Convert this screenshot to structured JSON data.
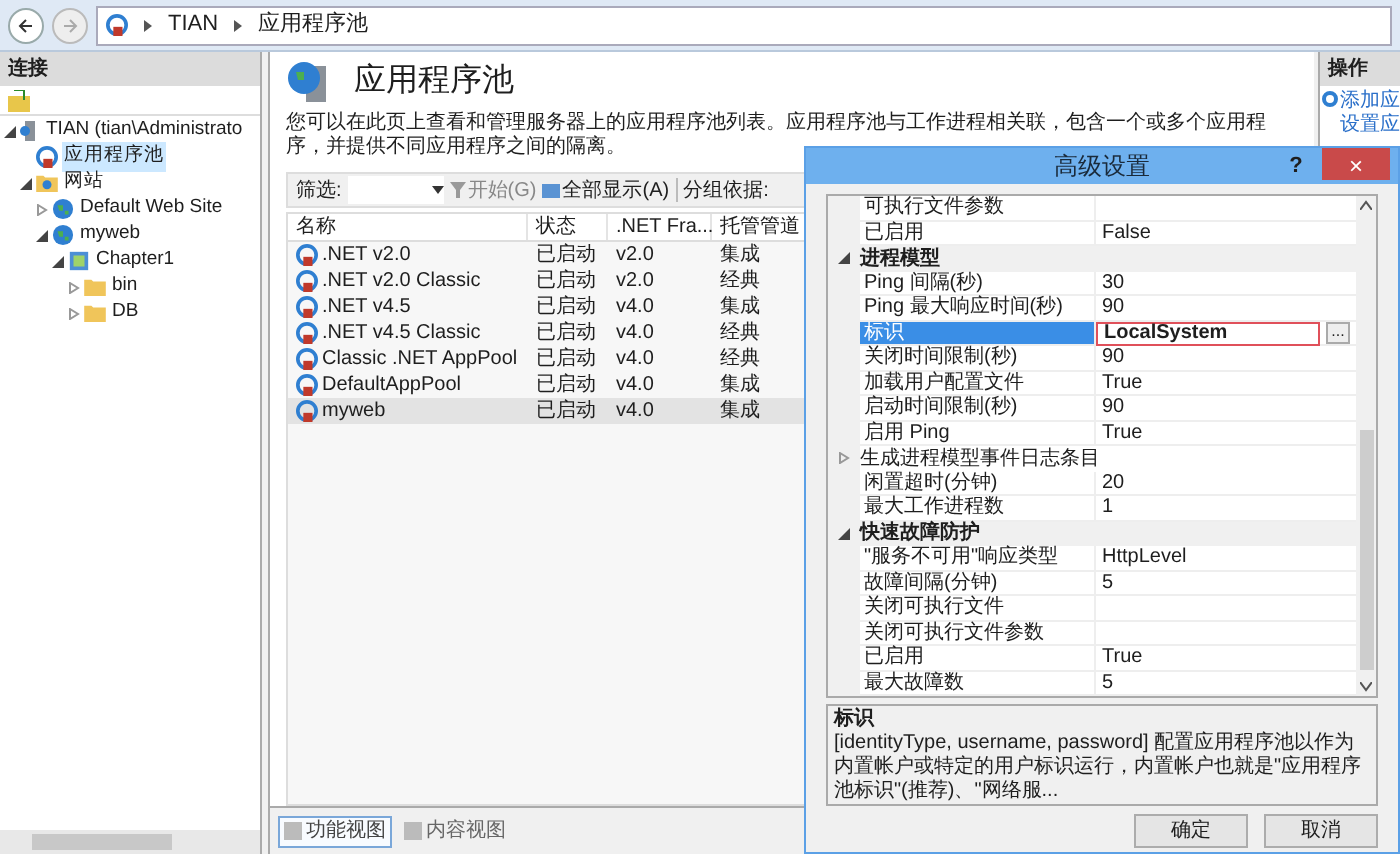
{
  "address_bar": {
    "crumbs": [
      "TIAN",
      "应用程序池"
    ]
  },
  "connections": {
    "title": "连接",
    "tree": [
      {
        "label": "TIAN (tian\\Administrato",
        "kind": "server",
        "selected": false,
        "expanded": true,
        "children": [
          {
            "label": "应用程序池",
            "kind": "pools",
            "selected": true
          },
          {
            "label": "网站",
            "kind": "sites",
            "selected": false,
            "expanded": true,
            "children": [
              {
                "label": "Default Web Site",
                "kind": "site",
                "selected": false,
                "expanded": false
              },
              {
                "label": "myweb",
                "kind": "site",
                "selected": false,
                "expanded": true,
                "children": [
                  {
                    "label": "Chapter1",
                    "kind": "app",
                    "selected": false,
                    "expanded": true,
                    "children": [
                      {
                        "label": "bin",
                        "kind": "folder",
                        "selected": false,
                        "expanded": false
                      },
                      {
                        "label": "DB",
                        "kind": "folder",
                        "selected": false,
                        "expanded": false
                      }
                    ]
                  }
                ]
              }
            ]
          }
        ]
      }
    ]
  },
  "page": {
    "title": "应用程序池",
    "description": "您可以在此页上查看和管理服务器上的应用程序池列表。应用程序池与工作进程相关联，包含一个或多个应用程序，并提供不同应用程序之间的隔离。"
  },
  "toolbar": {
    "filter_label": "筛选:",
    "start": "开始(G)",
    "show_all": "全部显示(A)",
    "group_by": "分组依据:"
  },
  "table": {
    "columns": [
      "名称",
      "状态",
      ".NET Fra...",
      "托管管道"
    ],
    "rows": [
      {
        "cells": [
          ".NET v2.0",
          "已启动",
          "v2.0",
          "集成"
        ],
        "selected": false
      },
      {
        "cells": [
          ".NET v2.0 Classic",
          "已启动",
          "v2.0",
          "经典"
        ],
        "selected": false
      },
      {
        "cells": [
          ".NET v4.5",
          "已启动",
          "v4.0",
          "集成"
        ],
        "selected": false
      },
      {
        "cells": [
          ".NET v4.5 Classic",
          "已启动",
          "v4.0",
          "经典"
        ],
        "selected": false
      },
      {
        "cells": [
          "Classic .NET AppPool",
          "已启动",
          "v4.0",
          "经典"
        ],
        "selected": false
      },
      {
        "cells": [
          "DefaultAppPool",
          "已启动",
          "v4.0",
          "集成"
        ],
        "selected": false
      },
      {
        "cells": [
          "myweb",
          "已启动",
          "v4.0",
          "集成"
        ],
        "selected": true
      }
    ]
  },
  "view_tabs": [
    {
      "label": "功能视图",
      "selected": true
    },
    {
      "label": "内容视图",
      "selected": false
    }
  ],
  "actions": {
    "title": "操作",
    "items": [
      "添加应",
      "设置应"
    ]
  },
  "dialog": {
    "title": "高级设置",
    "help": "?",
    "close": "×",
    "properties": [
      {
        "kind": "row",
        "name": "可执行文件参数",
        "selected": false,
        "outlined": false
      },
      {
        "kind": "row",
        "name": "已启用",
        "value": "False",
        "selected": false,
        "outlined": false
      },
      {
        "kind": "group",
        "name": "进程模型",
        "expanded": true
      },
      {
        "kind": "row",
        "name": "Ping 间隔(秒)",
        "value": "30",
        "selected": false,
        "outlined": false
      },
      {
        "kind": "row",
        "name": "Ping 最大响应时间(秒)",
        "value": "90",
        "selected": false,
        "outlined": false
      },
      {
        "kind": "row",
        "name": "标识",
        "value": "LocalSystem",
        "selected": true,
        "outlined": true
      },
      {
        "kind": "row",
        "name": "关闭时间限制(秒)",
        "value": "90",
        "selected": false,
        "outlined": false
      },
      {
        "kind": "row",
        "name": "加载用户配置文件",
        "value": "True",
        "selected": false,
        "outlined": false
      },
      {
        "kind": "row",
        "name": "启动时间限制(秒)",
        "value": "90",
        "selected": false,
        "outlined": false
      },
      {
        "kind": "row",
        "name": "启用 Ping",
        "value": "True",
        "selected": false,
        "outlined": false
      },
      {
        "kind": "subgroup",
        "name": "生成进程模型事件日志条目",
        "expanded": false
      },
      {
        "kind": "row",
        "name": "闲置超时(分钟)",
        "value": "20",
        "selected": false,
        "outlined": false
      },
      {
        "kind": "row",
        "name": "最大工作进程数",
        "value": "1",
        "selected": false,
        "outlined": false
      },
      {
        "kind": "group",
        "name": "快速故障防护",
        "expanded": true
      },
      {
        "kind": "row",
        "name": "\"服务不可用\"响应类型",
        "value": "HttpLevel",
        "selected": false,
        "outlined": false
      },
      {
        "kind": "row",
        "name": "故障间隔(分钟)",
        "value": "5",
        "selected": false,
        "outlined": false
      },
      {
        "kind": "row",
        "name": "关闭可执行文件",
        "selected": false,
        "outlined": false
      },
      {
        "kind": "row",
        "name": "关闭可执行文件参数",
        "selected": false,
        "outlined": false
      },
      {
        "kind": "row",
        "name": "已启用",
        "value": "True",
        "selected": false,
        "outlined": false
      },
      {
        "kind": "row",
        "name": "最大故障数",
        "value": "5",
        "selected": false,
        "outlined": false
      }
    ],
    "edit_button": "...",
    "help_title": "标识",
    "help_text": "[identityType, username, password] 配置应用程序池以作为内置帐户或特定的用户标识运行，内置帐户也就是\"应用程序池标识\"(推荐)、\"网络服...",
    "buttons": [
      "确定",
      "取消"
    ]
  }
}
